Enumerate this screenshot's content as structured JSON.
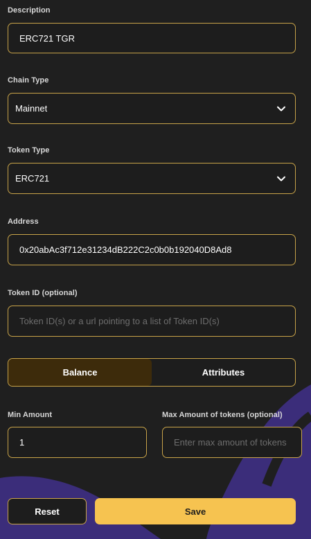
{
  "form": {
    "description": {
      "label": "Description",
      "value": "ERC721 TGR"
    },
    "chain_type": {
      "label": "Chain Type",
      "value": "Mainnet"
    },
    "token_type": {
      "label": "Token Type",
      "value": "ERC721"
    },
    "address": {
      "label": "Address",
      "value": "0x20abAc3f712e31234dB222C2c0b0b192040D8Ad8"
    },
    "token_id": {
      "label": "Token ID (optional)",
      "placeholder": "Token ID(s) or a url pointing to a list of Token ID(s)"
    },
    "mode_toggle": {
      "options": [
        "Balance",
        "Attributes"
      ],
      "selected": "Balance"
    },
    "min_amount": {
      "label": "Min Amount",
      "value": "1"
    },
    "max_amount": {
      "label": "Max Amount of tokens (optional)",
      "placeholder": "Enter max amount of tokens"
    }
  },
  "actions": {
    "reset_label": "Reset",
    "save_label": "Save"
  },
  "icons": {
    "select_arrow": "chevron-down-icon"
  },
  "colors": {
    "background": "#1f1f1f",
    "field_border": "#c9a449",
    "save_button": "#f6c350",
    "toggle_active": "#3d2b0b",
    "swoosh": "#3b2d7a"
  }
}
